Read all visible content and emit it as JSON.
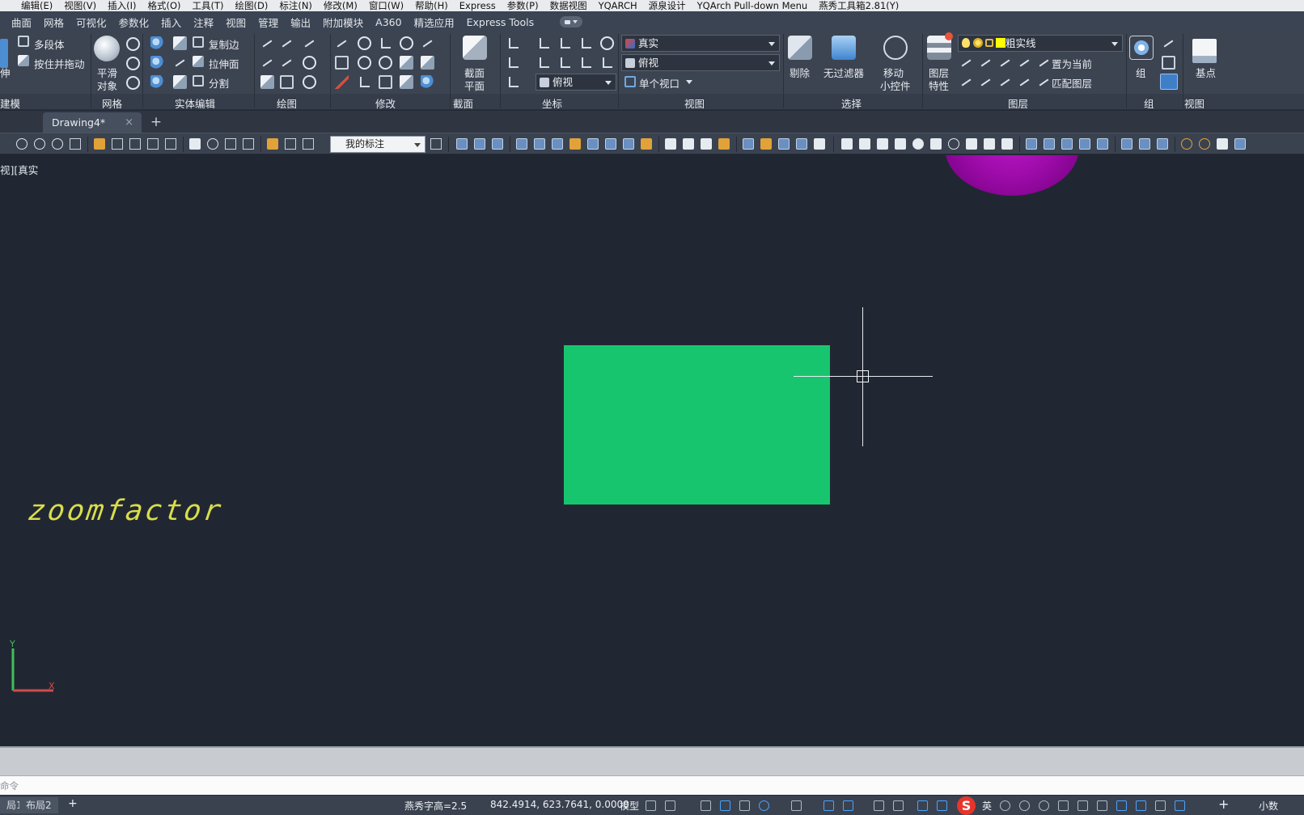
{
  "menubar": {
    "items": [
      "编辑(E)",
      "视图(V)",
      "插入(I)",
      "格式(O)",
      "工具(T)",
      "绘图(D)",
      "标注(N)",
      "修改(M)",
      "窗口(W)",
      "帮助(H)",
      "Express",
      "参数(P)",
      "数据视图",
      "YQARCH",
      "源泉设计",
      "YQArch Pull-down Menu",
      "燕秀工具箱2.81(Y)"
    ]
  },
  "ribbon_tabs": [
    "曲面",
    "网格",
    "可视化",
    "参数化",
    "插入",
    "注释",
    "视图",
    "管理",
    "输出",
    "附加模块",
    "A360",
    "精选应用",
    "Express Tools"
  ],
  "ribbon": {
    "modeling": {
      "polysolid": "多段体",
      "press_pull": "按住并拖动",
      "footer": "建模",
      "side_label": "伸"
    },
    "mesh": {
      "smooth_object_line1": "平滑",
      "smooth_object_line2": "对象",
      "footer": "网格"
    },
    "solid_edit": {
      "copy_edge": "复制边",
      "extrude_face": "拉伸面",
      "separate": "分割",
      "footer": "实体编辑"
    },
    "draw": {
      "footer": "绘图"
    },
    "modify": {
      "footer": "修改"
    },
    "section": {
      "section_plane_line1": "截面",
      "section_plane_line2": "平面",
      "footer": "截面"
    },
    "coordinates": {
      "view_dropdown": "俯视",
      "footer": "坐标"
    },
    "view": {
      "visual_style": "真实",
      "view_direction": "俯视",
      "viewport_config": "单个视口",
      "footer": "视图"
    },
    "selection": {
      "cull": "剔除",
      "no_filter": "无过滤器",
      "move_gizmo_line1": "移动",
      "move_gizmo_line2": "小控件",
      "footer": "选择"
    },
    "layers": {
      "layer_properties_line1": "图层",
      "layer_properties_line2": "特性",
      "current_layer": "粗实线",
      "set_current": "置为当前",
      "match_layer": "匹配图层",
      "footer": "图层"
    },
    "groups": {
      "group": "组",
      "footer": "组"
    },
    "view2": {
      "base_point": "基点",
      "footer": "视图"
    }
  },
  "doc_tabs": {
    "active": "Drawing4*",
    "close_glyph": "×",
    "new_glyph": "+"
  },
  "toolbar": {
    "dim_style": "我的标注"
  },
  "viewport": {
    "label": "视][真实",
    "text_object": "zoomfactor",
    "ucs_x": "X",
    "ucs_y": "Y"
  },
  "command": {
    "prompt": "命令"
  },
  "statusbar": {
    "layout_tab_1": "局1",
    "layout_tab_2": "布局2",
    "add_glyph": "+",
    "text_height": "燕秀字高=2.5",
    "coordinates": "842.4914, 623.7641, 0.0000",
    "model": "模型",
    "ime_lang": "英",
    "units": "小数"
  },
  "colors": {
    "canvas": "#212732",
    "rectangle_fill": "#18c56f",
    "sphere": "#9a0aa6",
    "annotation_text": "#d8de4a",
    "layer_swatch": "#ffff00"
  }
}
